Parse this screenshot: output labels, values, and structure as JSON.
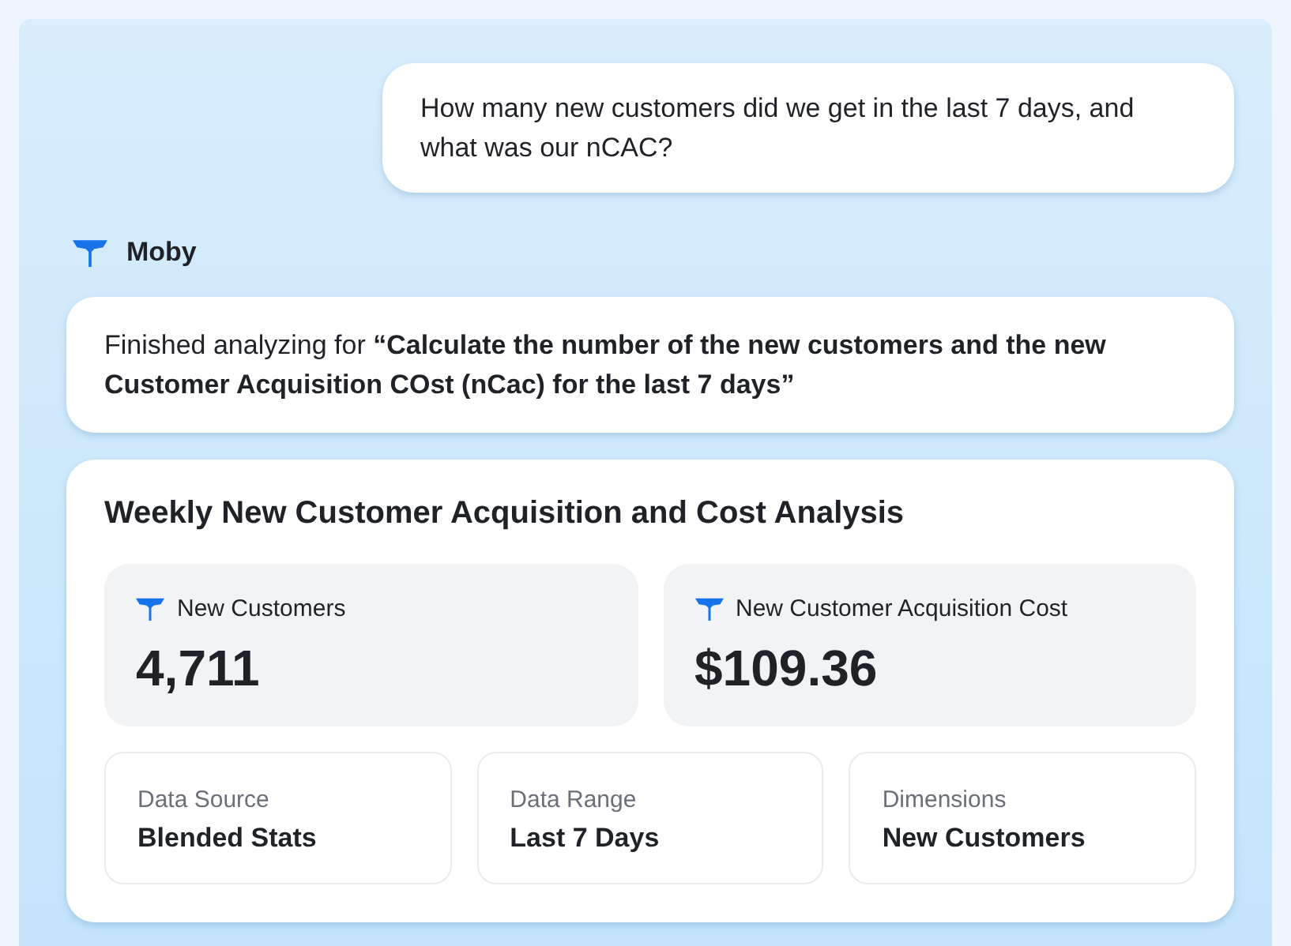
{
  "user_message": {
    "text": "How many new customers did we get in the last 7 days, and what was our nCAC?"
  },
  "assistant": {
    "name": "Moby"
  },
  "status_message": {
    "text": "Finished analyzing for **“Calculate the number of the new customers and the new Customer Acquisition COst (nCac) for the last 7 days”**"
  },
  "report": {
    "title": "Weekly New Customer Acquisition and Cost Analysis",
    "metrics": [
      {
        "label": "New Customers",
        "value": "4,711"
      },
      {
        "label": "New Customer Acquisition Cost",
        "value": "$109.36"
      }
    ],
    "details": [
      {
        "label": "Data Source",
        "value": "Blended Stats"
      },
      {
        "label": "Data Range",
        "value": "Last 7 Days"
      },
      {
        "label": "Dimensions",
        "value": "New Customers"
      }
    ]
  }
}
